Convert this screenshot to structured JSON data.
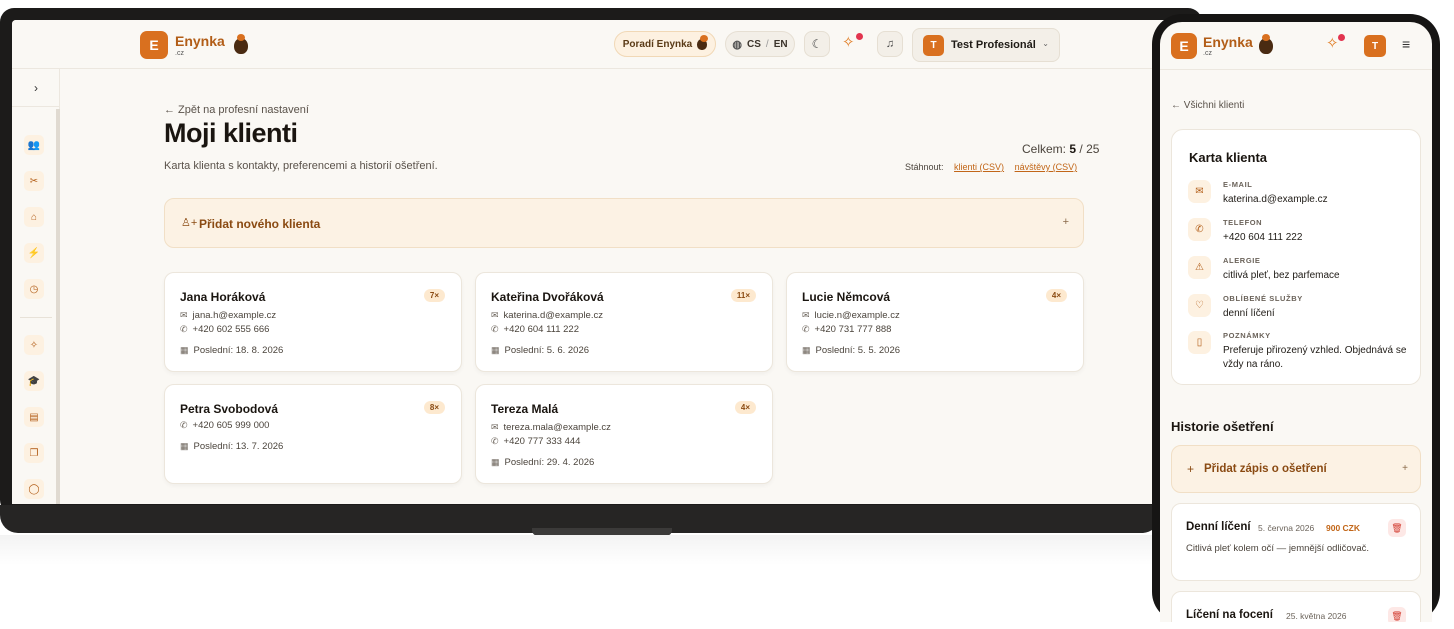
{
  "brand": {
    "letter": "E",
    "name": "Enynka",
    "tld": ".cz"
  },
  "header": {
    "advisor_label": "Poradí Enynka",
    "lang_cs": "CS",
    "lang_sep": "/",
    "lang_en": "EN",
    "profile_initial": "T",
    "profile_name": "Test Profesionál",
    "icons": [
      "globe-icon",
      "moon-icon",
      "sparkle-icon",
      "bell-icon",
      "chevron-down-icon"
    ]
  },
  "sidebar": {
    "toggle_icon": "chevron-right-icon",
    "items": [
      "users-icon",
      "scissors-icon",
      "home-icon",
      "lightning-icon",
      "clock-icon",
      "sparkle-icon",
      "graduation-cap-icon",
      "document-icon",
      "chat-bubbles-icon",
      "chat-icon"
    ]
  },
  "main": {
    "back_link": "← Zpět na profesní nastavení",
    "title": "Moji klienti",
    "subtitle": "Karta klienta s kontakty, preferencemi a historií ošetření.",
    "total_label": "Celkem:",
    "total_count": "5",
    "total_sep": "/",
    "total_max": "25",
    "download_label": "Stáhnout:",
    "download_clients": "klienti (CSV)",
    "download_visits": "návštěvy (CSV)",
    "add_client": "Přidat nového klienta",
    "add_symbol": "+",
    "clients": [
      {
        "name": "Jana Horáková",
        "count": "7×",
        "email": "jana.h@example.cz",
        "phone": "+420 602 555 666",
        "last": "Poslední: 18. 8. 2026"
      },
      {
        "name": "Kateřina Dvořáková",
        "count": "11×",
        "email": "katerina.d@example.cz",
        "phone": "+420 604 111 222",
        "last": "Poslední: 5. 6. 2026"
      },
      {
        "name": "Lucie Němcová",
        "count": "4×",
        "email": "lucie.n@example.cz",
        "phone": "+420 731 777 888",
        "last": "Poslední: 5. 5. 2026"
      },
      {
        "name": "Petra Svobodová",
        "count": "8×",
        "phone": "+420 605 999 000",
        "last": "Poslední: 13. 7. 2026"
      },
      {
        "name": "Tereza Malá",
        "count": "4×",
        "email": "tereza.mala@example.cz",
        "phone": "+420 777 333 444",
        "last": "Poslední: 29. 4. 2026"
      }
    ]
  },
  "mobile": {
    "back_link": "← Všichni klienti",
    "card_title": "Karta klienta",
    "fields": [
      {
        "label": "E-MAIL",
        "value": "katerina.d@example.cz",
        "icon": "mail-icon"
      },
      {
        "label": "TELEFON",
        "value": "+420 604 111 222",
        "icon": "phone-icon"
      },
      {
        "label": "ALERGIE",
        "value": "citlivá pleť, bez parfemace",
        "icon": "warning-icon"
      },
      {
        "label": "OBLÍBENÉ SLUŽBY",
        "value": "denní líčení",
        "icon": "heart-icon"
      },
      {
        "label": "POZNÁMKY",
        "value": "Preferuje přirozený vzhled. Objednává se vždy na ráno.",
        "icon": "note-icon"
      }
    ],
    "history_title": "Historie ošetření",
    "add_entry": "Přidat zápis o ošetření",
    "entries": [
      {
        "title": "Denní líčení",
        "date": "5. června 2026",
        "price": "900 CZK",
        "note": "Citlivá pleť kolem očí — jemnější odličovač."
      },
      {
        "title": "Líčení na focení",
        "date": "25. května 2026"
      }
    ]
  }
}
